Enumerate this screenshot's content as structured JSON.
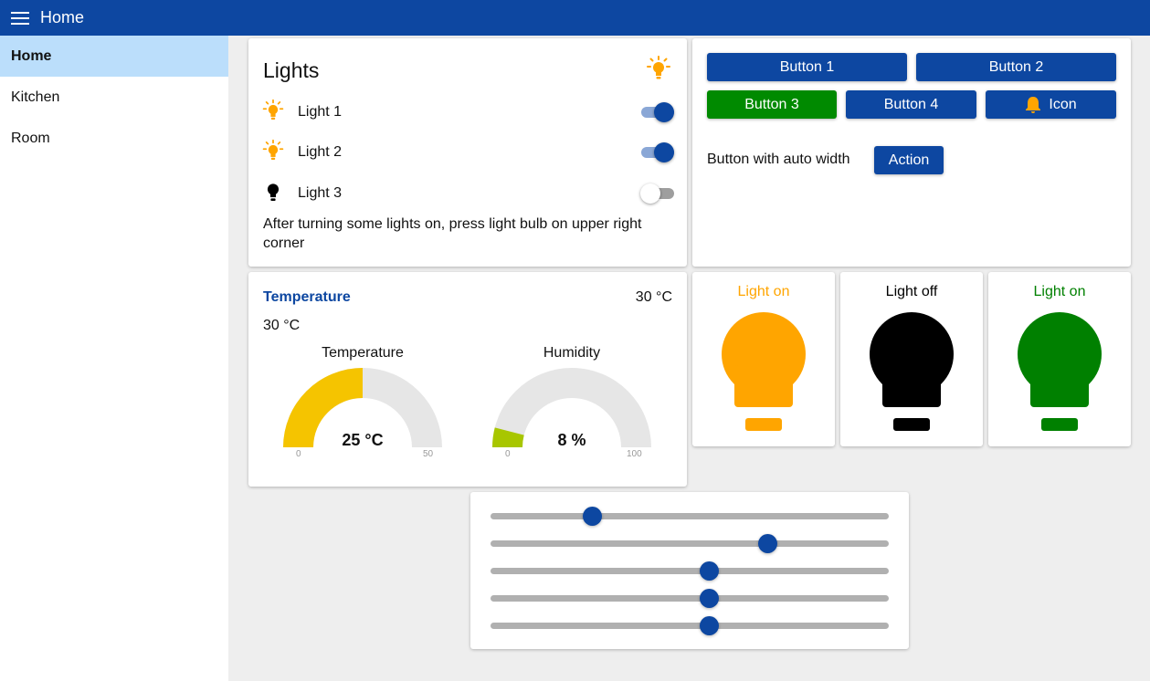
{
  "header": {
    "title": "Home",
    "menu_icon": "hamburger-menu-icon"
  },
  "sidebar": {
    "items": [
      {
        "label": "Home",
        "active": true
      },
      {
        "label": "Kitchen",
        "active": false
      },
      {
        "label": "Room",
        "active": false
      }
    ]
  },
  "lights_card": {
    "title": "Lights",
    "lights": [
      {
        "label": "Light 1",
        "on": true
      },
      {
        "label": "Light 2",
        "on": true
      },
      {
        "label": "Light 3",
        "on": false
      }
    ],
    "note": "After turning some lights on, press light bulb on upper right corner"
  },
  "buttons_card": {
    "button1": "Button 1",
    "button2": "Button 2",
    "button3": "Button 3",
    "button4": "Button 4",
    "icon_button": "Icon",
    "auto_width_label": "Button with auto width",
    "action_button": "Action"
  },
  "temperature_card": {
    "title": "Temperature",
    "value": "30 °C",
    "subvalue": "30 °C",
    "gauges": [
      {
        "label": "Temperature",
        "display": "25 °C",
        "value": 25,
        "min": "0",
        "max": "50",
        "color": "#f5c400"
      },
      {
        "label": "Humidity",
        "display": "8 %",
        "value": 8,
        "min": "0",
        "max": "100",
        "color": "#a8c600"
      }
    ]
  },
  "bulb_cards": [
    {
      "title": "Light on",
      "color": "#ffa500"
    },
    {
      "title": "Light off",
      "color": "#000000"
    },
    {
      "title": "Light on",
      "color": "#008000"
    }
  ],
  "sliders": [
    {
      "value": 0.255
    },
    {
      "value": 0.695
    },
    {
      "value": 0.548
    },
    {
      "value": 0.548
    },
    {
      "value": 0.548
    }
  ],
  "colors": {
    "primary": "#0d47a1",
    "accent_green": "#008a00",
    "bulb_orange": "#ffa500",
    "nav_active": "#bbdefb"
  }
}
